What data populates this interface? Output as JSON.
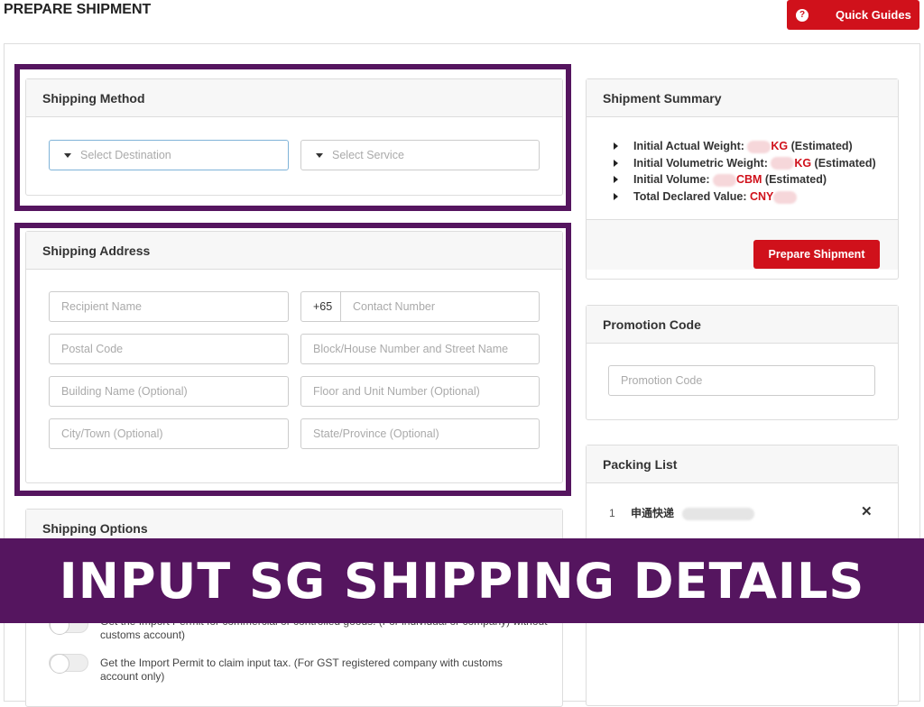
{
  "header": {
    "title": "PREPARE SHIPMENT",
    "quick_guides": "Quick Guides",
    "help_icon": "?"
  },
  "shipping_method": {
    "title": "Shipping Method",
    "destination_placeholder": "Select Destination",
    "service_placeholder": "Select Service"
  },
  "shipping_address": {
    "title": "Shipping Address",
    "recipient": "Recipient Name",
    "country_code": "+65",
    "contact": "Contact Number",
    "postal": "Postal Code",
    "street": "Block/House Number and Street Name",
    "building": "Building Name (Optional)",
    "unit": "Floor and Unit Number (Optional)",
    "city": "City/Town (Optional)",
    "state": "State/Province (Optional)"
  },
  "shipping_options": {
    "title": "Shipping Options",
    "options": [
      "Get the Import Permit for commercial or controlled goods. (For individual or company) without customs account)",
      "Get the Import Permit to claim input tax. (For GST registered company with customs account only)"
    ]
  },
  "summary": {
    "title": "Shipment Summary",
    "items": [
      {
        "label": "Initial Actual Weight: ",
        "unit": "KG",
        "suffix": " (Estimated)"
      },
      {
        "label": "Initial Volumetric Weight: ",
        "unit": "KG",
        "suffix": " (Estimated)"
      },
      {
        "label": "Initial Volume: ",
        "unit": "CBM",
        "suffix": " (Estimated)"
      },
      {
        "label": "Total Declared Value: ",
        "unit": "CNY",
        "suffix": ""
      }
    ],
    "button": "Prepare Shipment"
  },
  "promotion": {
    "title": "Promotion Code",
    "placeholder": "Promotion Code"
  },
  "packing": {
    "title": "Packing List",
    "items": [
      {
        "index": "1",
        "name": "申通快递"
      }
    ]
  },
  "banner": "INPUT SG SHIPPING DETAILS",
  "colors": {
    "accent": "#d0111b",
    "highlight": "#55155f"
  }
}
